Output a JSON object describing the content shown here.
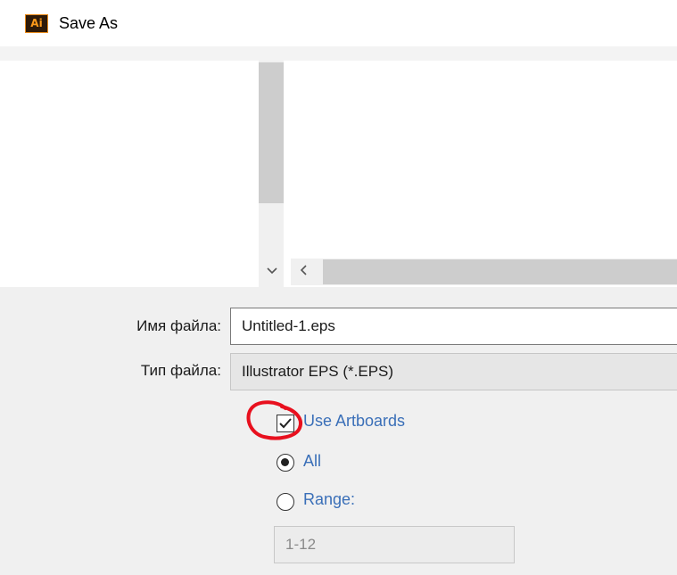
{
  "window": {
    "app_icon_text": "Ai",
    "title": "Save As"
  },
  "form": {
    "file_name_label": "Имя файла:",
    "file_name_value": "Untitled-1.eps",
    "file_type_label": "Тип файла:",
    "file_type_value": "Illustrator EPS (*.EPS)"
  },
  "options": {
    "use_artboards_label": "Use Artboards",
    "use_artboards_checked": true,
    "all_label": "All",
    "all_selected": true,
    "range_label": "Range:",
    "range_selected": false,
    "range_value": "1-12"
  },
  "colors": {
    "accent_link": "#3a6fb8",
    "annotation": "#e8101e",
    "panel_bg": "#f0f0f0"
  }
}
